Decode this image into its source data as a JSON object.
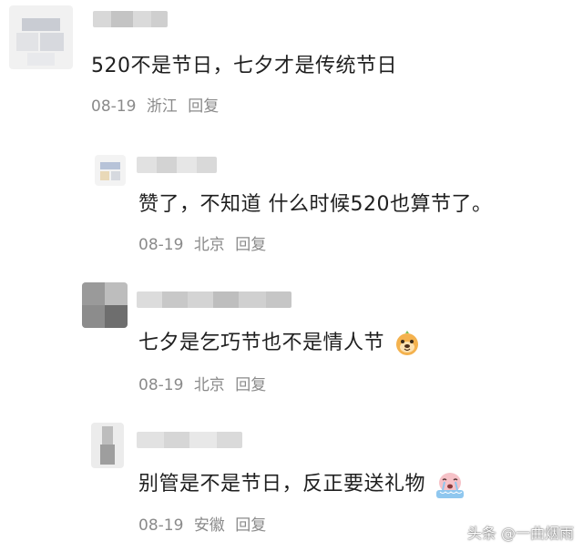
{
  "comments": [
    {
      "content": "520不是节日，七夕才是传统节日",
      "date": "08-19",
      "location": "浙江",
      "reply_label": "回复"
    },
    {
      "content": "赞了，不知道 什么时候520也算节了。",
      "date": "08-19",
      "location": "北京",
      "reply_label": "回复"
    },
    {
      "content": "七夕是乞巧节也不是情人节",
      "emoji": "dog-face-emoji",
      "date": "08-19",
      "location": "北京",
      "reply_label": "回复"
    },
    {
      "content": "别管是不是节日，反正要送礼物",
      "emoji": "crying-face-emoji",
      "date": "08-19",
      "location": "安徽",
      "reply_label": "回复"
    }
  ],
  "watermark": "头条 @一曲烟雨",
  "colors": {
    "text": "#1f1f1f",
    "meta": "#8a8a8a",
    "background": "#ffffff"
  }
}
